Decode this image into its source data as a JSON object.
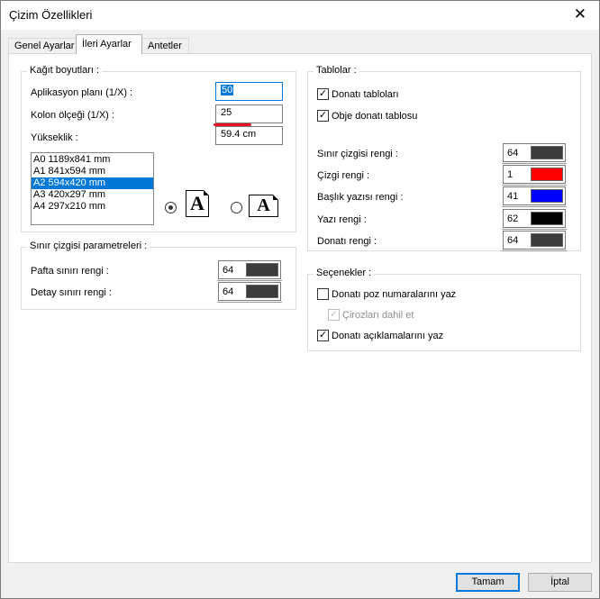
{
  "window": {
    "title": "Çizim Özellikleri"
  },
  "tabs": [
    {
      "label": "Genel Ayarlar",
      "active": false
    },
    {
      "label": "İleri Ayarlar",
      "active": true
    },
    {
      "label": "Antetler",
      "active": false
    }
  ],
  "paper": {
    "legend": "Kağıt boyutları :",
    "app_scale_label": "Aplikasyon planı (1/X) :",
    "app_scale_value": "50",
    "column_scale_label": "Kolon ölçeği (1/X) :",
    "column_scale_value": "25",
    "height_label": "Yükseklik :",
    "height_value": "59.4 cm",
    "sizes": [
      "A0 1189x841 mm",
      "A1 841x594 mm",
      "A2 594x420 mm",
      "A3 420x297 mm",
      "A4 297x210 mm"
    ],
    "selected_size": "A2 594x420 mm",
    "orientation_glyph": "A",
    "orientation": "portrait"
  },
  "border": {
    "legend": "Sınır çizgisi parametreleri :",
    "sheet_label": "Pafta sınırı rengi :",
    "sheet_value": "64",
    "sheet_color": "#3c3c3c",
    "detail_label": "Detay sınırı rengi :",
    "detail_value": "64",
    "detail_color": "#3c3c3c"
  },
  "tables": {
    "legend": "Tablolar :",
    "rebar_tables_label": "Donatı tabloları",
    "rebar_tables_checked": true,
    "object_table_label": "Obje donatı tablosu",
    "object_table_checked": true,
    "colors": [
      {
        "label": "Sınır çizgisi rengi :",
        "value": "64",
        "color": "#3c3c3c"
      },
      {
        "label": "Çizgi rengi :",
        "value": "1",
        "color": "#ff0000"
      },
      {
        "label": "Başlık yazısı rengi :",
        "value": "41",
        "color": "#0000ff"
      },
      {
        "label": "Yazı rengi :",
        "value": "62",
        "color": "#000000"
      },
      {
        "label": "Donatı rengi :",
        "value": "64",
        "color": "#3c3c3c"
      }
    ]
  },
  "options": {
    "legend": "Seçenekler :",
    "items": [
      {
        "label": "Donatı poz numaralarını yaz",
        "checked": false,
        "disabled": false
      },
      {
        "label": "Çirozları dahil et",
        "checked": true,
        "disabled": true
      },
      {
        "label": "Donatı açıklamalarını yaz",
        "checked": true,
        "disabled": false
      }
    ]
  },
  "buttons": {
    "ok": "Tamam",
    "cancel": "İptal"
  }
}
